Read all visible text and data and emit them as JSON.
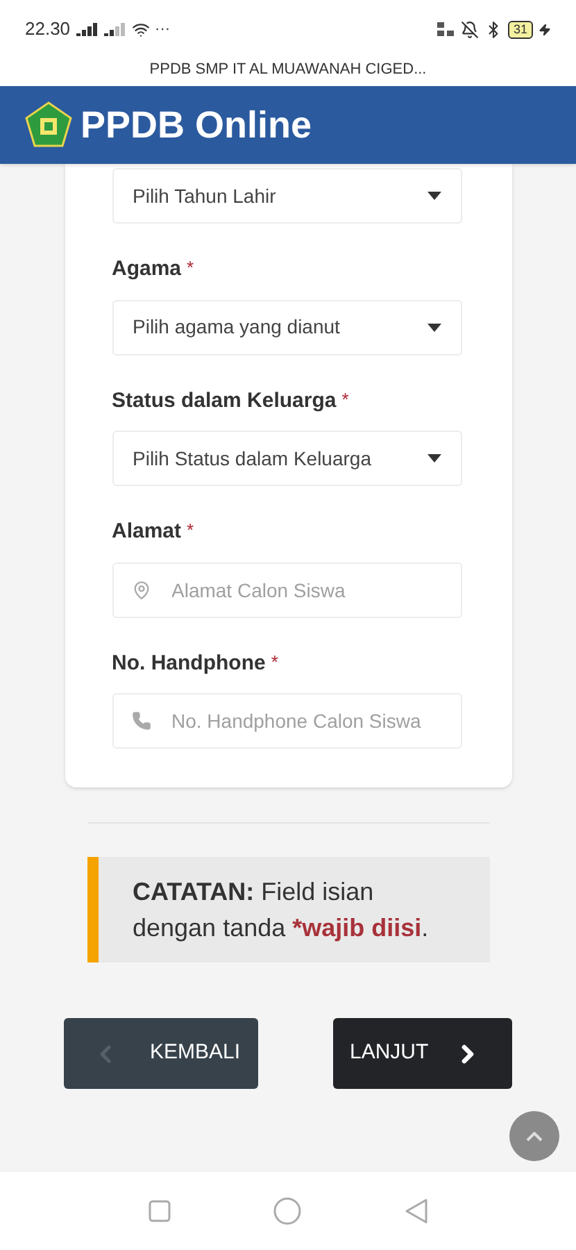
{
  "status_bar": {
    "time": "22.30",
    "more": "···",
    "battery": "31"
  },
  "page_title": "PPDB SMP IT AL MUAWANAH CIGED...",
  "header": {
    "title": "PPDB Online"
  },
  "form": {
    "fields": [
      {
        "kind": "select",
        "placeholder": "Pilih Tahun Lahir"
      },
      {
        "kind": "select",
        "label": "Agama",
        "required_mark": "*",
        "placeholder": "Pilih agama yang dianut"
      },
      {
        "kind": "select",
        "label": "Status dalam Keluarga",
        "required_mark": "*",
        "placeholder": "Pilih Status dalam Keluarga"
      },
      {
        "kind": "address",
        "label": "Alamat",
        "required_mark": "*",
        "placeholder": "Alamat Calon Siswa"
      },
      {
        "kind": "phone",
        "label": "No. Handphone",
        "required_mark": "*",
        "placeholder": "No. Handphone Calon Siswa"
      }
    ]
  },
  "note": {
    "label": "CATATAN:",
    "text": "Field isian dengan tanda",
    "mark": "*wajib diisi",
    "end": "."
  },
  "buttons": [
    {
      "kind": "back",
      "label": "KEMBALI"
    },
    {
      "kind": "next",
      "label": "LANJUT"
    }
  ]
}
